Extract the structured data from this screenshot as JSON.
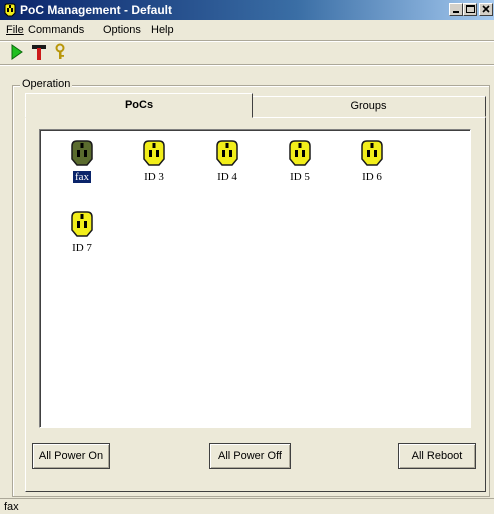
{
  "window": {
    "title": "PoC Management - Default",
    "controls": [
      "minimize",
      "maximize",
      "close"
    ]
  },
  "menu": [
    "File",
    "Commands",
    "Options",
    "Help"
  ],
  "toolbar": {
    "buttons": [
      "play-icon",
      "tools-icon",
      "key-icon"
    ]
  },
  "operation": {
    "label": "Operation",
    "tabs": [
      {
        "label": "PoCs",
        "active": true
      },
      {
        "label": "Groups",
        "active": false
      }
    ],
    "pocs": [
      {
        "label": "fax",
        "selected": true,
        "color": "#5a6b2e"
      },
      {
        "label": "ID 3",
        "selected": false,
        "color": "#f2ee1a"
      },
      {
        "label": "ID 4",
        "selected": false,
        "color": "#f2ee1a"
      },
      {
        "label": "ID 5",
        "selected": false,
        "color": "#f2ee1a"
      },
      {
        "label": "ID 6",
        "selected": false,
        "color": "#f2ee1a"
      },
      {
        "label": "ID 7",
        "selected": false,
        "color": "#f2ee1a"
      }
    ],
    "buttons": {
      "all_power_on": "All Power On",
      "all_power_off": "All Power Off",
      "all_reboot": "All Reboot"
    }
  },
  "status": {
    "text": "fax"
  },
  "colors": {
    "title_bar": "#0a246a",
    "selection": "#0a246a",
    "window_bg": "#ece9d8"
  }
}
